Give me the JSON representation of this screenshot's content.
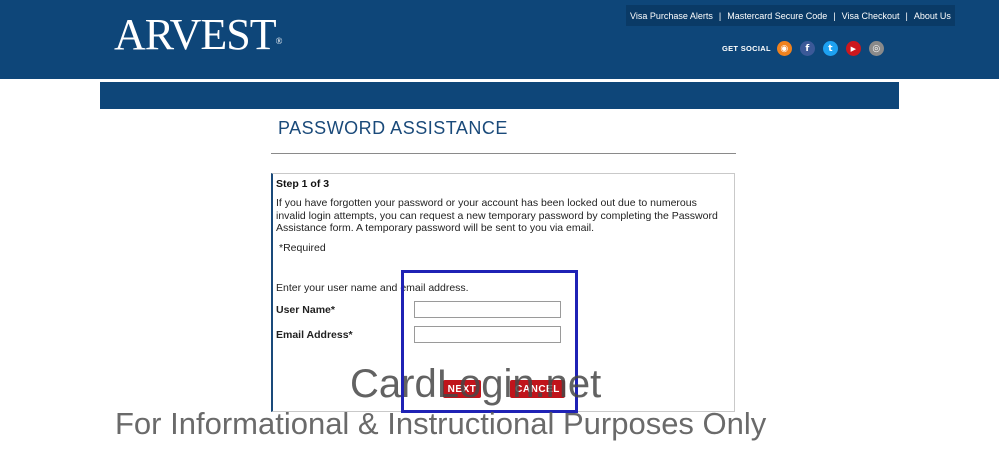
{
  "header": {
    "logo_text": "ARVEST",
    "logo_mark": "®",
    "links": [
      "Visa Purchase Alerts",
      "Mastercard Secure Code",
      "Visa Checkout",
      "About Us"
    ],
    "social_label": "GET SOCIAL",
    "social_icons": [
      {
        "name": "rss-icon",
        "color": "#f0821e",
        "glyph": "◉"
      },
      {
        "name": "facebook-icon",
        "color": "#3b5998",
        "glyph": "f"
      },
      {
        "name": "twitter-icon",
        "color": "#1da1f2",
        "glyph": "t"
      },
      {
        "name": "youtube-icon",
        "color": "#cc181e",
        "glyph": "▶"
      },
      {
        "name": "instagram-icon",
        "color": "#8a8a8a",
        "glyph": "◎"
      }
    ]
  },
  "page": {
    "title": "PASSWORD ASSISTANCE",
    "step": "Step 1 of 3",
    "description": "If you have forgotten your password or your account has been locked out due to numerous invalid login attempts, you can request a new temporary password by completing the Password Assistance form. A temporary password will be sent to you via email.",
    "required_note": "*Required",
    "instruction": "Enter your user name and email address."
  },
  "form": {
    "user_name_label": "User Name*",
    "user_name_value": "",
    "email_label": "Email Address*",
    "email_value": "",
    "next_label": "NEXT",
    "cancel_label": "CANCEL"
  },
  "watermark": {
    "main": "CardLogin.net",
    "sub": "For Informational & Instructional Purposes Only"
  },
  "colors": {
    "brand_blue": "#0e4679",
    "button_red": "#c0141b",
    "highlight_blue": "#1f22b5"
  }
}
